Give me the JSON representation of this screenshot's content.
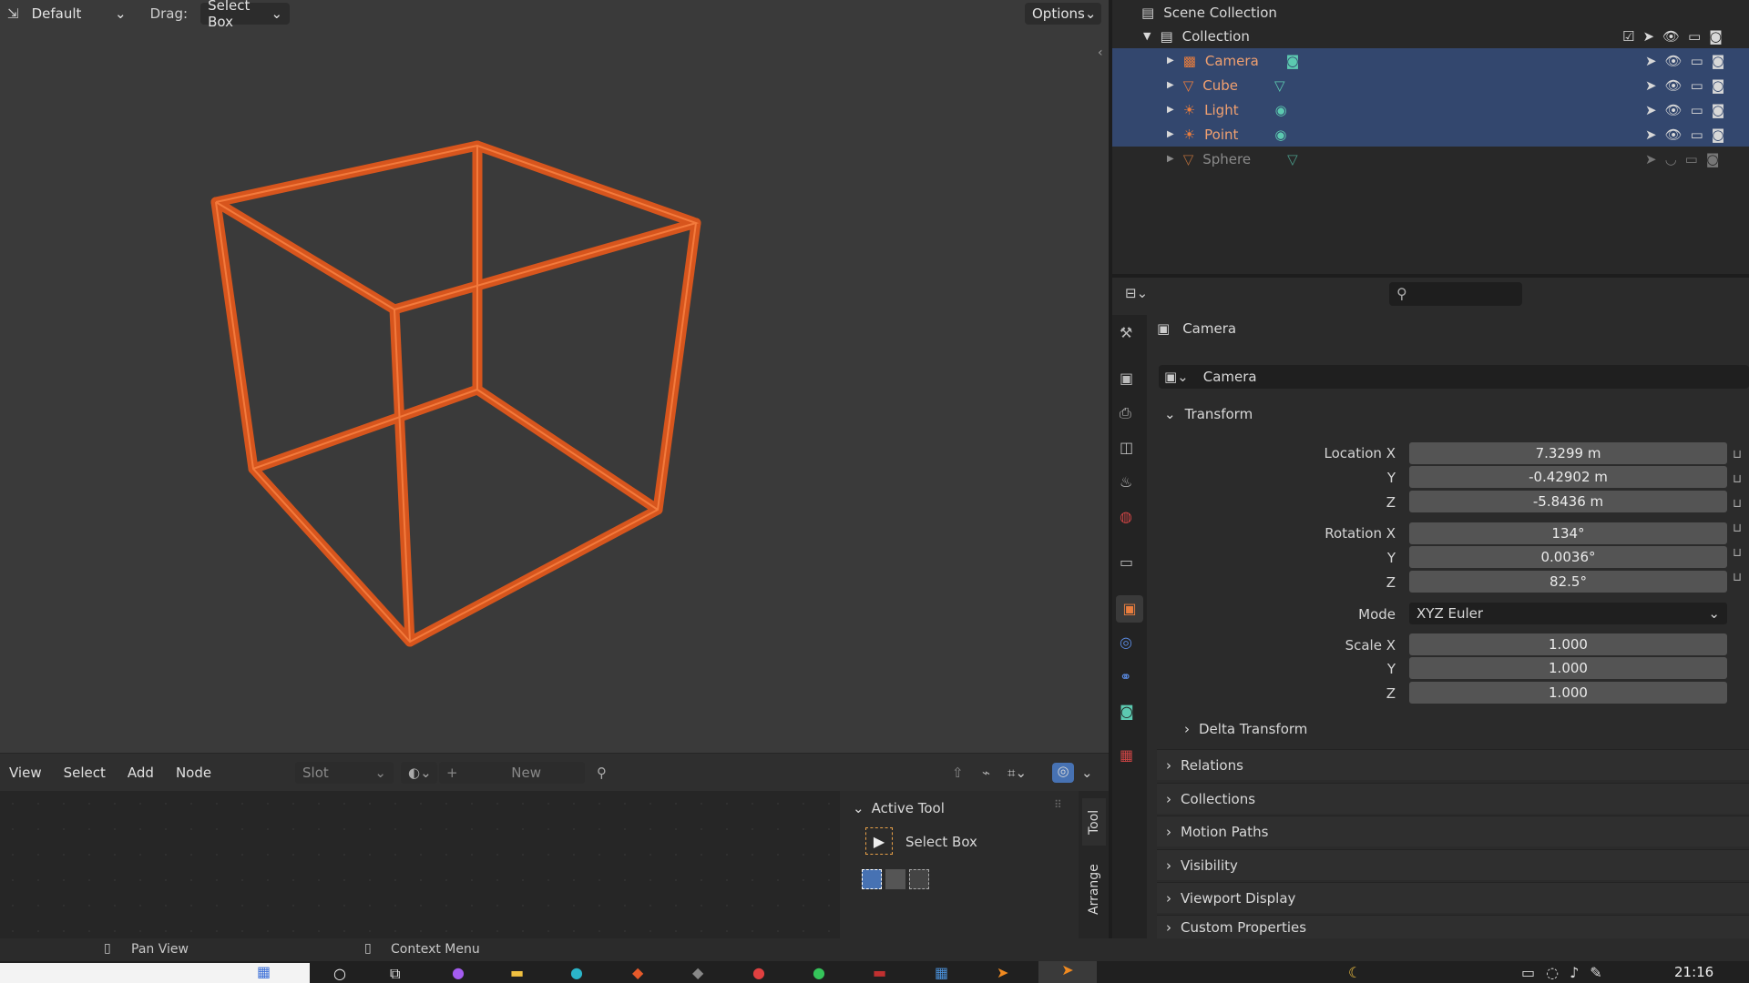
{
  "viewport_header": {
    "mode": "Default",
    "drag_label": "Drag:",
    "drag_value": "Select Box",
    "options": "Options"
  },
  "outliner": {
    "root": "Scene Collection",
    "collection": "Collection",
    "items": [
      {
        "name": "Camera",
        "selected": true
      },
      {
        "name": "Cube",
        "selected": true
      },
      {
        "name": "Light",
        "selected": true
      },
      {
        "name": "Point",
        "selected": true
      },
      {
        "name": "Sphere",
        "selected": false
      }
    ]
  },
  "properties": {
    "object_name": "Camera",
    "data_name": "Camera",
    "transform_title": "Transform",
    "location_label": "Location X",
    "loc_x": "7.3299 m",
    "loc_y": "-0.42902 m",
    "loc_z": "-5.8436 m",
    "rotation_label": "Rotation X",
    "rot_x": "134°",
    "rot_y": "0.0036°",
    "rot_z": "82.5°",
    "mode_label": "Mode",
    "mode_value": "XYZ Euler",
    "scale_label": "Scale X",
    "scale_x": "1.000",
    "scale_y": "1.000",
    "scale_z": "1.000",
    "y_label": "Y",
    "z_label": "Z",
    "sections": [
      "Delta Transform",
      "Relations",
      "Collections",
      "Motion Paths",
      "Visibility",
      "Viewport Display",
      "Custom Properties"
    ]
  },
  "node_editor": {
    "menus": [
      "View",
      "Select",
      "Add",
      "Node"
    ],
    "slot": "Slot",
    "new_label": "New"
  },
  "active_tool": {
    "title": "Active Tool",
    "tool": "Select Box",
    "tab_tool": "Tool",
    "tab_arrange": "Arrange"
  },
  "statusbar": {
    "pan": "Pan View",
    "context": "Context Menu"
  },
  "taskbar": {
    "time": "21:16"
  },
  "colors": {
    "selection": "#e8591a",
    "accent_blue": "#33476e",
    "active_orange": "#e87d3e"
  }
}
